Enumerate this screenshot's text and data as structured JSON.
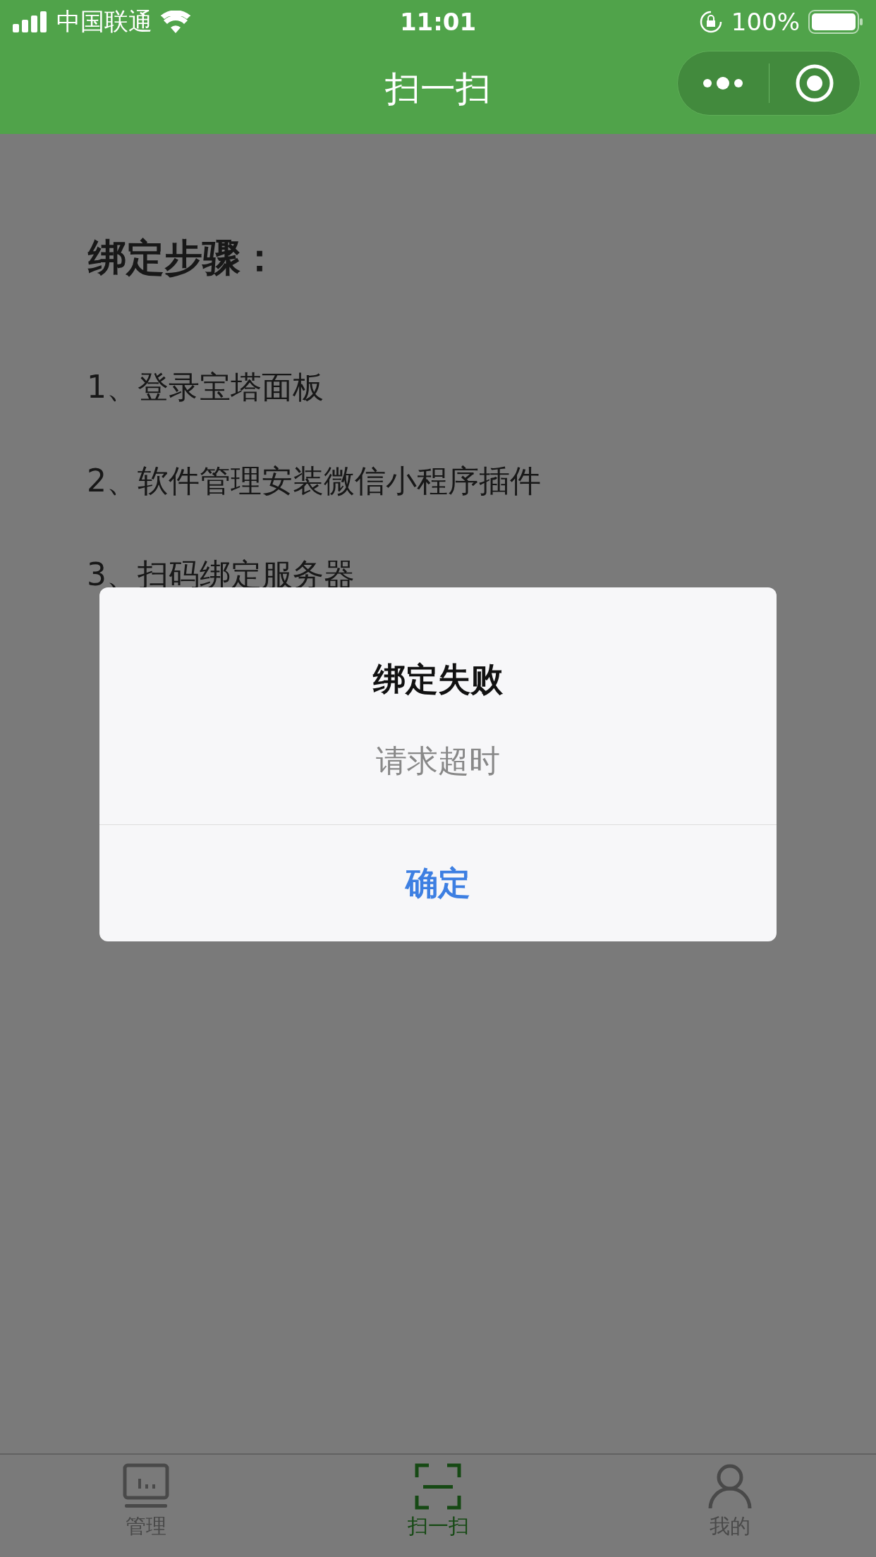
{
  "status_bar": {
    "carrier": "中国联通",
    "time": "11:01",
    "battery": "100%"
  },
  "nav_bar": {
    "title": "扫一扫"
  },
  "content": {
    "heading": "绑定步骤：",
    "steps": [
      "1、登录宝塔面板",
      "2、软件管理安装微信小程序插件",
      "3、扫码绑定服务器"
    ]
  },
  "dialog": {
    "title": "绑定失败",
    "message": "请求超时",
    "button": "确定"
  },
  "tab_bar": [
    {
      "kind": "dashboard",
      "label": "管理",
      "selected": false
    },
    {
      "kind": "scan",
      "label": "扫一扫",
      "selected": true
    },
    {
      "kind": "person",
      "label": "我的",
      "selected": false
    }
  ]
}
